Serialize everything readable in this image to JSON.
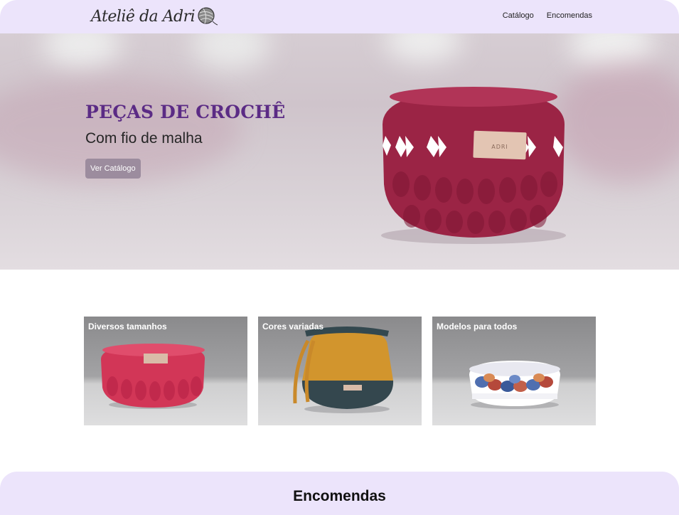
{
  "header": {
    "logo_text": "Ateliê da Adri",
    "logo_icon": "yarn-ball-icon",
    "nav": [
      {
        "label": "Catálogo"
      },
      {
        "label": "Encomendas"
      }
    ]
  },
  "hero": {
    "title": "PEÇAS DE CROCHÊ",
    "subtitle": "Com fio de malha",
    "button_label": "Ver Catálogo",
    "image": "crochet-basket-image"
  },
  "cards": [
    {
      "label": "Diversos tamanhos",
      "image": "pink-basket-image"
    },
    {
      "label": "Cores variadas",
      "image": "drawstring-bag-image"
    },
    {
      "label": "Modelos para todos",
      "image": "patterned-bowl-image"
    }
  ],
  "bottom": {
    "title": "Encomendas"
  },
  "colors": {
    "header_bg": "#ece4fb",
    "hero_title": "#5b2b85",
    "button_bg": "#9c8c9e"
  }
}
